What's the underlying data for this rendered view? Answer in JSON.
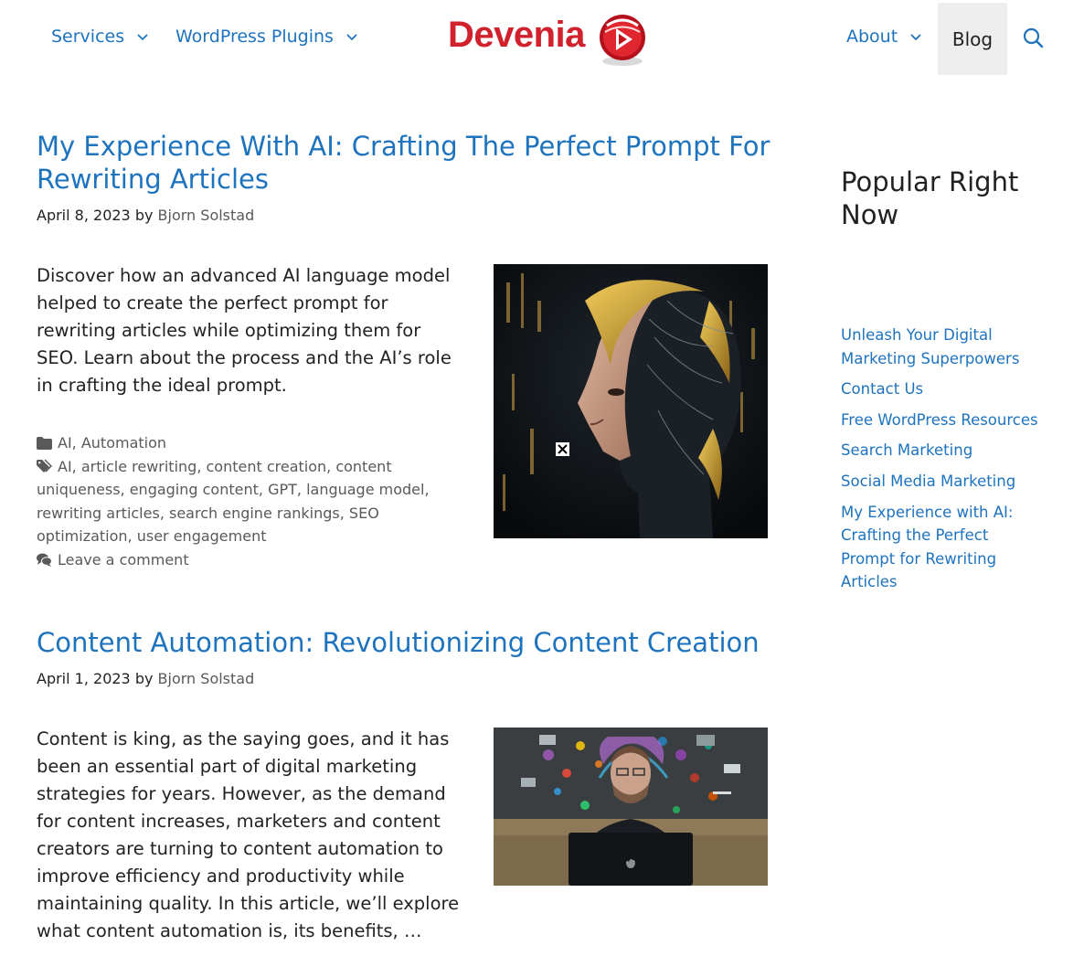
{
  "nav": {
    "services": "Services",
    "plugins": "WordPress Plugins",
    "about": "About",
    "blog": "Blog"
  },
  "logo": {
    "text": "Devenia"
  },
  "posts": [
    {
      "title": "My Experience With AI: Crafting The Perfect Prompt For Rewriting Articles",
      "date": "April 8, 2023",
      "by": "by",
      "author": "Bjorn Solstad",
      "excerpt": "Discover how an advanced AI language model helped to create the perfect prompt for rewriting articles while optimizing them for SEO. Learn about the process and the AI’s role in crafting the ideal prompt.",
      "image_alt": "AI robot head illustration",
      "categories": [
        "AI",
        "Automation"
      ],
      "tags": [
        "AI",
        "article rewriting",
        "content creation",
        "content uniqueness",
        "engaging content",
        "GPT",
        "language model",
        "rewriting articles",
        "search engine rankings",
        "SEO optimization",
        "user engagement"
      ],
      "comment": "Leave a comment"
    },
    {
      "title": "Content Automation: Revolutionizing Content Creation",
      "date": "April 1, 2023",
      "by": "by",
      "author": "Bjorn Solstad",
      "excerpt": "Content is king, as the saying goes, and it has been an essential part of digital marketing strategies for years. However, as the demand for content increases, marketers and content creators are turning to content automation to improve efficiency and productivity while maintaining quality. In this article, we’ll explore what content automation is, its benefits, …",
      "image_alt": "Man at laptop with content icons"
    }
  ],
  "sidebar": {
    "title": "Popular Right Now",
    "items": [
      "Unleash Your Digital Marketing Superpowers",
      "Contact Us",
      "Free WordPress Resources",
      "Search Marketing",
      "Social Media Marketing",
      "My Experience with AI: Crafting the Perfect Prompt for Rewriting Articles"
    ]
  },
  "colors": {
    "link": "#1e73be",
    "brand": "#d0212c",
    "text": "#222222",
    "meta": "#595959"
  },
  "icons": [
    "chevron-down-icon",
    "search-icon",
    "folder-icon",
    "tag-icon",
    "comments-icon",
    "close-icon"
  ]
}
